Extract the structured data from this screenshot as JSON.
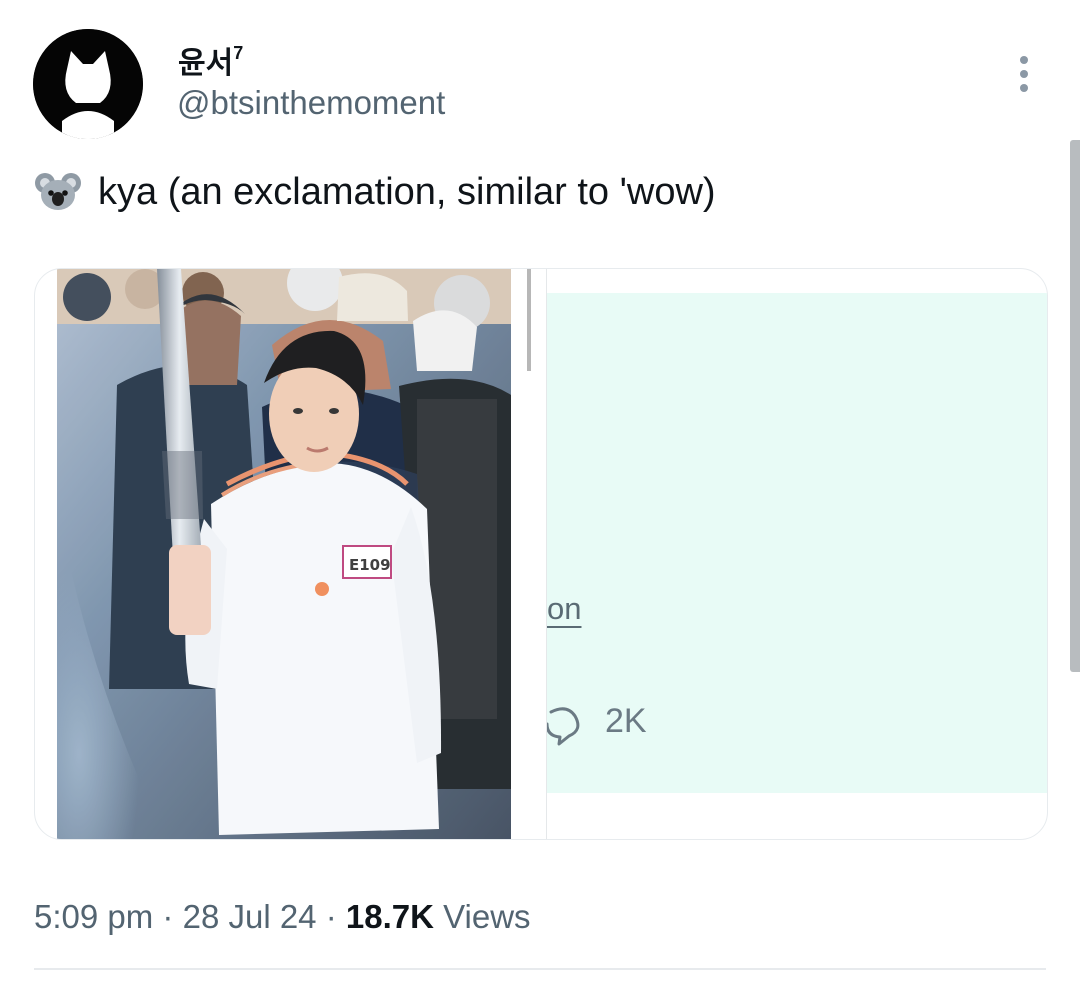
{
  "tweet": {
    "author": {
      "display_name": "윤서",
      "display_suffix": "7",
      "handle": "@btsinthemoment",
      "avatar_icon": "cat-silhouette-avatar"
    },
    "more_icon": "more-vertical-icon",
    "text": "kya (an exclamation, similar to 'wow)",
    "text_emoji_icon": "koala-icon",
    "media": {
      "photo_icon": "torchbearer-photo",
      "quoted_link_text": "on",
      "reply_count": "2K",
      "reply_icon": "reply-icon"
    },
    "meta": {
      "time": "5:09 pm",
      "separator": "·",
      "date": "28 Jul 24",
      "views_count": "18.7K",
      "views_label": "Views"
    }
  },
  "colors": {
    "primary_text": "#0f1419",
    "secondary_text": "#536471",
    "quoted_panel": "#e8fbf6"
  }
}
